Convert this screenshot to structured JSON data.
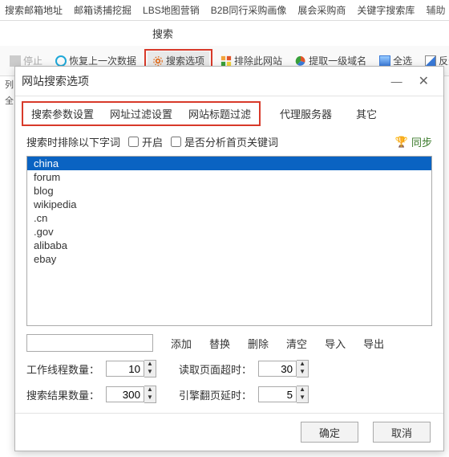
{
  "topTabs": {
    "t1": "搜索邮箱地址",
    "t2": "邮箱诱捕挖掘",
    "t3": "LBS地图营销",
    "t4": "B2B同行采购画像",
    "t5": "展会采购商",
    "t6": "关键字搜索库",
    "right": "辅助"
  },
  "searchLabel": "搜索",
  "toolbar": {
    "stop": "停止",
    "restore": "恢复上一次数据",
    "options": "搜索选项",
    "exclude": "排除此网站",
    "domain": "提取一级域名",
    "selectAll": "全选",
    "invert": "反选"
  },
  "sideLabels": {
    "l1": "列",
    "l2": "全"
  },
  "dialog": {
    "title": "网站搜索选项",
    "tabs": {
      "t1": "搜索参数设置",
      "t2": "网址过滤设置",
      "t3": "网站标题过滤",
      "t4": "代理服务器",
      "t5": "其它"
    },
    "excludeLabel": "搜索时排除以下字词",
    "enableLabel": "开启",
    "analyzeLabel": "是否分析首页关键词",
    "syncLabel": "同步",
    "list": [
      "china",
      "forum",
      "blog",
      "wikipedia",
      ".cn",
      ".gov",
      "alibaba",
      "ebay"
    ],
    "actions": {
      "add": "添加",
      "replace": "替换",
      "delete": "删除",
      "clear": "清空",
      "import": "导入",
      "export": "导出"
    },
    "num": {
      "threadsLabel": "工作线程数量：",
      "threads": "10",
      "timeoutLabel": "读取页面超时：",
      "timeout": "30",
      "resultsLabel": "搜索结果数量：",
      "results": "300",
      "flipLabel": "引擎翻页延时：",
      "flip": "5"
    },
    "ok": "确定",
    "cancel": "取消"
  }
}
